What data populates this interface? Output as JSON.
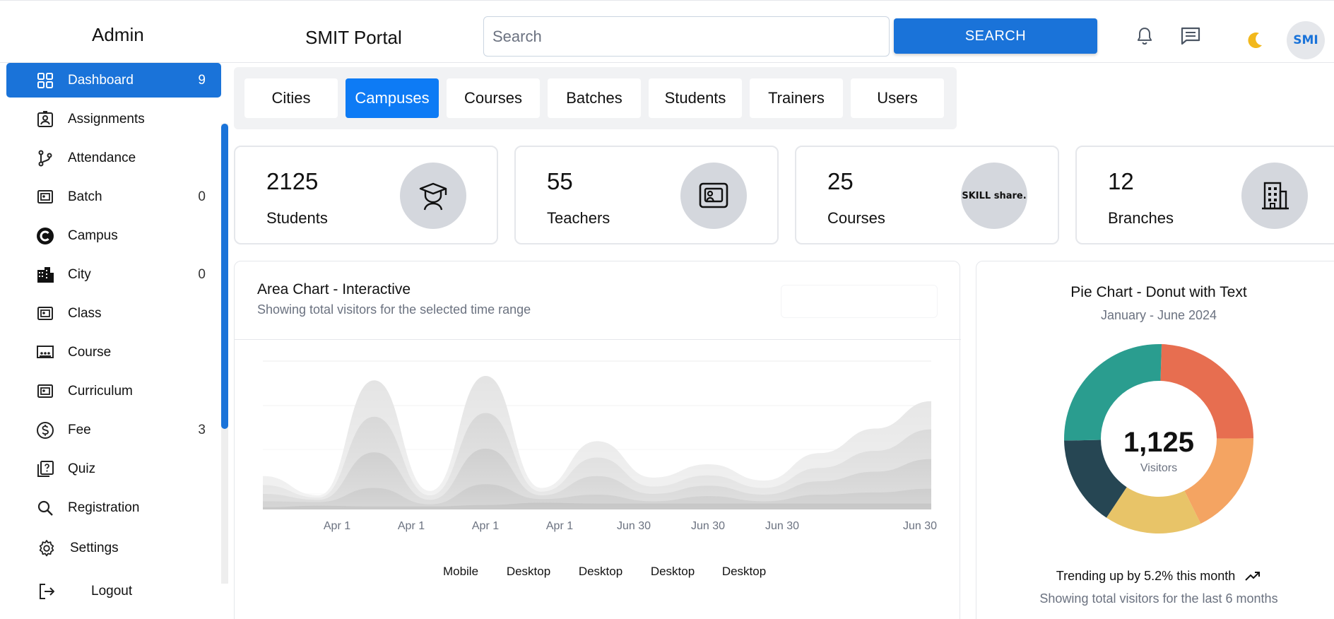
{
  "header": {
    "admin_title": "Admin",
    "portal_title": "SMIT Portal",
    "search_placeholder": "Search",
    "search_value": "",
    "search_button": "SEARCH",
    "icons": [
      "bell-icon",
      "message-icon",
      "moon-icon"
    ],
    "avatar_text": "SMI"
  },
  "sidebar": {
    "items": [
      {
        "label": "Dashboard",
        "count": "9",
        "icon": "grid-icon",
        "active": true
      },
      {
        "label": "Assignments",
        "count": "",
        "icon": "id-badge-icon"
      },
      {
        "label": "Attendance",
        "count": "",
        "icon": "branch-icon"
      },
      {
        "label": "Batch",
        "count": "0",
        "icon": "presentation-icon"
      },
      {
        "label": "Campus",
        "count": "",
        "icon": "campus-c-icon"
      },
      {
        "label": "City",
        "count": "0",
        "icon": "city-icon"
      },
      {
        "label": "Class",
        "count": "",
        "icon": "presentation-icon"
      },
      {
        "label": "Course",
        "count": "",
        "icon": "classroom-icon"
      },
      {
        "label": "Curriculum",
        "count": "",
        "icon": "presentation-icon"
      },
      {
        "label": "Fee",
        "count": "3",
        "icon": "dollar-icon"
      },
      {
        "label": "Quiz",
        "count": "",
        "icon": "quiz-icon"
      },
      {
        "label": "Registration",
        "count": "",
        "icon": "search-icon"
      },
      {
        "label": "Settings",
        "count": "",
        "icon": "gear-icon"
      },
      {
        "label": "Logout",
        "count": "",
        "icon": "logout-icon"
      }
    ]
  },
  "tabs": [
    {
      "label": "Cities",
      "active": false
    },
    {
      "label": "Campuses",
      "active": true
    },
    {
      "label": "Courses",
      "active": false
    },
    {
      "label": "Batches",
      "active": false
    },
    {
      "label": "Students",
      "active": false
    },
    {
      "label": "Trainers",
      "active": false
    },
    {
      "label": "Users",
      "active": false
    }
  ],
  "stats": [
    {
      "value": "2125",
      "label": "Students",
      "icon": "graduate-icon"
    },
    {
      "value": "55",
      "label": "Teachers",
      "icon": "presentation-icon"
    },
    {
      "value": "25",
      "label": "Courses",
      "icon": "skillshare-logo",
      "logo_text": "SKILL share."
    },
    {
      "value": "12",
      "label": "Branches",
      "icon": "building-icon"
    }
  ],
  "area_chart": {
    "title": "Area Chart - Interactive",
    "subtitle": "Showing total visitors for the selected time range"
  },
  "pie_chart": {
    "title": "Pie Chart - Donut with Text",
    "subtitle": "January - June 2024",
    "center_value": "1,125",
    "center_label": "Visitors",
    "trend": "Trending up by 5.2% this month",
    "footer": "Showing total visitors for the last 6 months"
  },
  "chart_data": [
    {
      "type": "area",
      "title": "Area Chart - Interactive",
      "x": [
        "Apr 1",
        "Apr 1",
        "Apr 1",
        "Apr 1",
        "Jun 30",
        "Jun 30",
        "Jun 30",
        "Jun 30"
      ],
      "legend": [
        "Mobile",
        "Desktop",
        "Desktop",
        "Desktop",
        "Desktop"
      ],
      "stacked": true,
      "grid": true,
      "series": [
        {
          "name": "Mobile",
          "values": [
            3,
            5,
            4,
            4,
            6,
            9,
            8,
            8,
            8,
            8,
            8,
            8,
            8
          ],
          "color": "#7a7a7a"
        },
        {
          "name": "Desktop",
          "values": [
            8,
            5,
            25,
            3,
            28,
            5,
            12,
            3,
            10,
            3,
            12,
            15,
            20
          ],
          "color": "#9a9a9a"
        },
        {
          "name": "Desktop",
          "values": [
            10,
            3,
            48,
            6,
            48,
            5,
            25,
            10,
            14,
            9,
            18,
            28,
            40
          ],
          "color": "#b4b4b4"
        },
        {
          "name": "Desktop",
          "values": [
            12,
            3,
            48,
            6,
            48,
            5,
            25,
            10,
            14,
            9,
            18,
            28,
            40
          ],
          "color": "#cdcdcd"
        },
        {
          "name": "Desktop",
          "values": [
            12,
            3,
            49,
            6,
            50,
            5,
            22,
            12,
            15,
            10,
            20,
            30,
            38
          ],
          "color": "#e2e2e2"
        }
      ]
    },
    {
      "type": "pie",
      "title": "Pie Chart - Donut with Text",
      "donut": true,
      "total": 1125,
      "slices": [
        {
          "value": 275,
          "color": "#e76e50"
        },
        {
          "value": 200,
          "color": "#f4a462"
        },
        {
          "value": 187,
          "color": "#e8c468"
        },
        {
          "value": 173,
          "color": "#264653"
        },
        {
          "value": 290,
          "color": "#2a9d8f"
        }
      ]
    }
  ],
  "colors": {
    "accent": "#1a73d9",
    "tab_active": "#0d7bf5",
    "icon_bg": "#d4d7dd"
  }
}
